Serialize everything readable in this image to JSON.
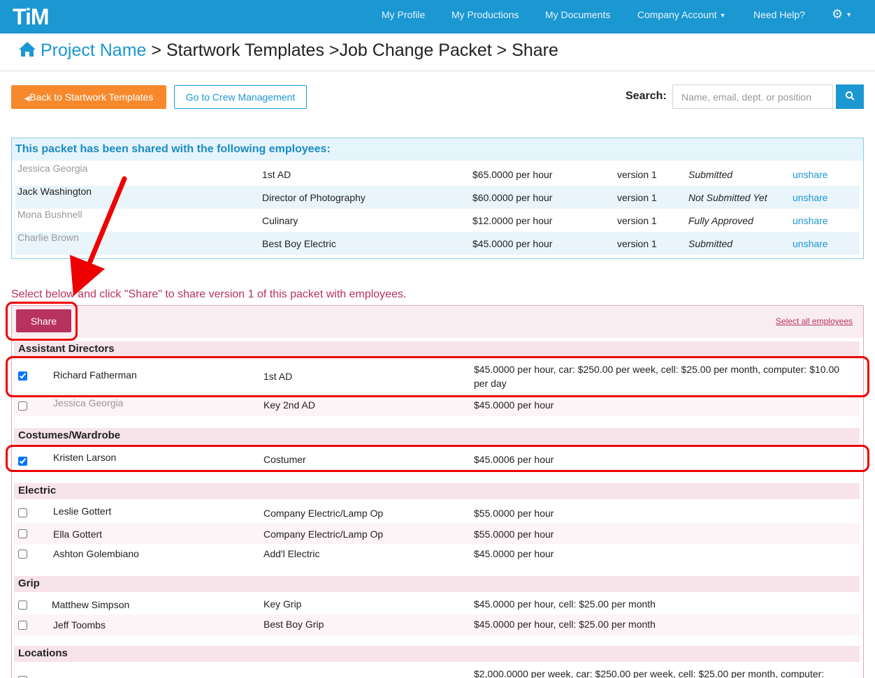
{
  "navbar": {
    "logo": "TiM",
    "items": [
      "My Profile",
      "My Productions",
      "My Documents",
      "Company Account",
      "Need Help?"
    ]
  },
  "breadcrumb": {
    "home": "Project Name",
    "rest": "> Startwork Templates >Job Change Packet > Share"
  },
  "toolbar": {
    "back_label": "Back to Startwork Templates",
    "crew_label": "Go to Crew Management",
    "search_label": "Search:",
    "search_placeholder": "Name, email, dept. or position"
  },
  "shared": {
    "heading": "This packet has been shared with the following employees:",
    "rows": [
      {
        "name": "Jessica Georgia",
        "position": "1st AD",
        "rate": "$65.0000 per hour",
        "version": "version 1",
        "status": "Submitted",
        "action": "unshare"
      },
      {
        "name": "Jack Washington",
        "position": "Director of Photography",
        "rate": "$60.0000 per hour",
        "version": "version 1",
        "status": "Not Submitted Yet",
        "action": "unshare"
      },
      {
        "name": "Mona Bushnell",
        "position": "Culinary",
        "rate": "$12.0000 per hour",
        "version": "version 1",
        "status": "Fully Approved",
        "action": "unshare"
      },
      {
        "name": "Charlie Brown",
        "position": "Best Boy Electric",
        "rate": "$45.0000 per hour",
        "version": "version 1",
        "status": "Submitted",
        "action": "unshare"
      }
    ]
  },
  "share": {
    "instructions": "Select below and click \"Share\" to share version 1 of this packet with employees.",
    "share_label": "Share",
    "select_all_label": "Select all employees",
    "groups": [
      {
        "name": "Assistant Directors",
        "employees": [
          {
            "name": "Richard Fatherman",
            "position": "1st AD",
            "rate_line1": "$45.0000 per hour, car: $250.00 per week, cell: $25.00 per month, computer: $10.00",
            "rate_line2": "per day"
          },
          {
            "name": "Jessica Georgia",
            "position": "Key 2nd AD",
            "rate": "$45.0000 per hour"
          }
        ]
      },
      {
        "name": "Costumes/Wardrobe",
        "employees": [
          {
            "name": "Kristen Larson",
            "position": "Costumer",
            "rate": "$45.0006 per hour"
          }
        ]
      },
      {
        "name": "Electric",
        "employees": [
          {
            "name": "Leslie Gottert",
            "position": "Company Electric/Lamp Op",
            "rate": "$55.0000 per hour"
          },
          {
            "name": "Ella Gottert",
            "position": "Company Electric/Lamp Op",
            "rate": "$55.0000 per hour"
          },
          {
            "name": "Ashton Golembiano",
            "position": "Add'l Electric",
            "rate": "$45.0000 per hour"
          }
        ]
      },
      {
        "name": "Grip",
        "employees": [
          {
            "name": "Matthew Simpson",
            "position": "Key Grip",
            "rate": "$45.0000 per hour, cell: $25.00 per month"
          },
          {
            "name": "Jeff Toombs",
            "position": "Best Boy Grip",
            "rate": "$45.0000 per hour, cell: $25.00 per month"
          }
        ]
      },
      {
        "name": "Locations",
        "employees": [
          {
            "name": "",
            "position": "",
            "rate": "$2,000.0000 per week, car: $250.00 per week, cell: $25.00 per month, computer:"
          }
        ]
      }
    ]
  },
  "colors": {
    "nav": "#1b97d1",
    "accent_orange": "#f7892c",
    "share": "#b8325f",
    "annotation": "#ee0000"
  }
}
